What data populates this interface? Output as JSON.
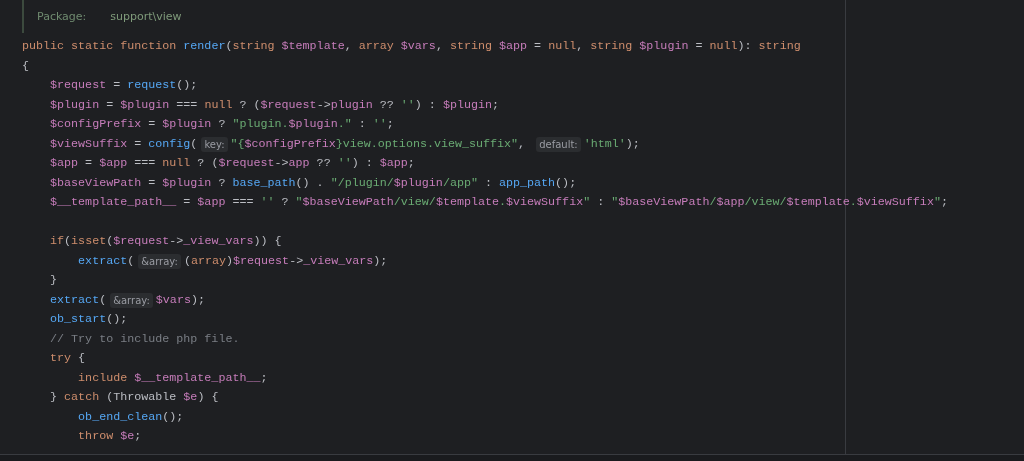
{
  "doc_comment": {
    "label": "Package:",
    "value": "support\\view"
  },
  "lines": [
    {
      "kind": "code",
      "segments": [
        {
          "kind": "code",
          "tokens": [
            {
              "kind": "keyword",
              "text": "public static function "
            },
            {
              "kind": "function",
              "text": "render"
            },
            {
              "kind": "plain",
              "text": "("
            },
            {
              "kind": "keyword",
              "text": "string "
            },
            {
              "kind": "variable",
              "text": "$template"
            },
            {
              "kind": "plain",
              "text": ", "
            },
            {
              "kind": "keyword",
              "text": "array "
            },
            {
              "kind": "variable",
              "text": "$vars"
            },
            {
              "kind": "plain",
              "text": ", "
            },
            {
              "kind": "keyword",
              "text": "string "
            },
            {
              "kind": "variable",
              "text": "$app"
            },
            {
              "kind": "plain",
              "text": " = "
            },
            {
              "kind": "keyword",
              "text": "null"
            },
            {
              "kind": "plain",
              "text": ", "
            },
            {
              "kind": "keyword",
              "text": "string "
            },
            {
              "kind": "variable",
              "text": "$plugin"
            },
            {
              "kind": "plain",
              "text": " = "
            },
            {
              "kind": "keyword",
              "text": "null"
            },
            {
              "kind": "plain",
              "text": "): "
            },
            {
              "kind": "keyword",
              "text": "string"
            }
          ]
        }
      ]
    },
    {
      "kind": "code",
      "segments": [
        {
          "kind": "code",
          "tokens": [
            {
              "kind": "plain",
              "text": "{"
            }
          ]
        }
      ]
    },
    {
      "kind": "code",
      "segments": [
        {
          "kind": "code",
          "tokens": [
            {
              "kind": "variable",
              "text": "    $request"
            },
            {
              "kind": "plain",
              "text": " = "
            },
            {
              "kind": "function",
              "text": "request"
            },
            {
              "kind": "plain",
              "text": "();"
            }
          ]
        }
      ]
    },
    {
      "kind": "code",
      "segments": [
        {
          "kind": "code",
          "tokens": [
            {
              "kind": "variable",
              "text": "    $plugin"
            },
            {
              "kind": "plain",
              "text": " = "
            },
            {
              "kind": "variable",
              "text": "$plugin"
            },
            {
              "kind": "plain",
              "text": " === "
            },
            {
              "kind": "keyword",
              "text": "null"
            },
            {
              "kind": "plain",
              "text": " ? ("
            },
            {
              "kind": "variable",
              "text": "$request"
            },
            {
              "kind": "plain",
              "text": "->"
            },
            {
              "kind": "variable",
              "text": "plugin"
            },
            {
              "kind": "plain",
              "text": " ?? "
            },
            {
              "kind": "string",
              "text": "''"
            },
            {
              "kind": "plain",
              "text": ") : "
            },
            {
              "kind": "variable",
              "text": "$plugin"
            },
            {
              "kind": "plain",
              "text": ";"
            }
          ]
        }
      ]
    },
    {
      "kind": "code",
      "segments": [
        {
          "kind": "code",
          "tokens": [
            {
              "kind": "variable",
              "text": "    $configPrefix"
            },
            {
              "kind": "plain",
              "text": " = "
            },
            {
              "kind": "variable",
              "text": "$plugin"
            },
            {
              "kind": "plain",
              "text": " ? "
            },
            {
              "kind": "string",
              "text": "\"plugin."
            },
            {
              "kind": "variable",
              "text": "$plugin"
            },
            {
              "kind": "string",
              "text": ".\""
            },
            {
              "kind": "plain",
              "text": " : "
            },
            {
              "kind": "string",
              "text": "''"
            },
            {
              "kind": "plain",
              "text": ";"
            }
          ]
        }
      ]
    },
    {
      "kind": "code",
      "segments": [
        {
          "kind": "code",
          "tokens": [
            {
              "kind": "variable",
              "text": "    $viewSuffix"
            },
            {
              "kind": "plain",
              "text": " = "
            },
            {
              "kind": "function",
              "text": "config"
            },
            {
              "kind": "plain",
              "text": "("
            }
          ]
        },
        {
          "kind": "hint",
          "text": "key:"
        },
        {
          "kind": "code",
          "tokens": [
            {
              "kind": "string",
              "text": "\"{"
            },
            {
              "kind": "variable",
              "text": "$configPrefix"
            },
            {
              "kind": "string",
              "text": "}view.options.view_suffix\""
            },
            {
              "kind": "plain",
              "text": ", "
            }
          ]
        },
        {
          "kind": "hint",
          "text": "default:"
        },
        {
          "kind": "code",
          "tokens": [
            {
              "kind": "string",
              "text": "'html'"
            },
            {
              "kind": "plain",
              "text": ");"
            }
          ]
        }
      ]
    },
    {
      "kind": "code",
      "segments": [
        {
          "kind": "code",
          "tokens": [
            {
              "kind": "variable",
              "text": "    $app"
            },
            {
              "kind": "plain",
              "text": " = "
            },
            {
              "kind": "variable",
              "text": "$app"
            },
            {
              "kind": "plain",
              "text": " === "
            },
            {
              "kind": "keyword",
              "text": "null"
            },
            {
              "kind": "plain",
              "text": " ? ("
            },
            {
              "kind": "variable",
              "text": "$request"
            },
            {
              "kind": "plain",
              "text": "->"
            },
            {
              "kind": "variable",
              "text": "app"
            },
            {
              "kind": "plain",
              "text": " ?? "
            },
            {
              "kind": "string",
              "text": "''"
            },
            {
              "kind": "plain",
              "text": ") : "
            },
            {
              "kind": "variable",
              "text": "$app"
            },
            {
              "kind": "plain",
              "text": ";"
            }
          ]
        }
      ]
    },
    {
      "kind": "code",
      "segments": [
        {
          "kind": "code",
          "tokens": [
            {
              "kind": "variable",
              "text": "    $baseViewPath"
            },
            {
              "kind": "plain",
              "text": " = "
            },
            {
              "kind": "variable",
              "text": "$plugin"
            },
            {
              "kind": "plain",
              "text": " ? "
            },
            {
              "kind": "function",
              "text": "base_path"
            },
            {
              "kind": "plain",
              "text": "() . "
            },
            {
              "kind": "string",
              "text": "\"/plugin/"
            },
            {
              "kind": "variable",
              "text": "$plugin"
            },
            {
              "kind": "string",
              "text": "/app\""
            },
            {
              "kind": "plain",
              "text": " : "
            },
            {
              "kind": "function",
              "text": "app_path"
            },
            {
              "kind": "plain",
              "text": "();"
            }
          ]
        }
      ]
    },
    {
      "kind": "code",
      "segments": [
        {
          "kind": "code",
          "tokens": [
            {
              "kind": "variable",
              "text": "    $__template_path__"
            },
            {
              "kind": "plain",
              "text": " = "
            },
            {
              "kind": "variable",
              "text": "$app"
            },
            {
              "kind": "plain",
              "text": " === "
            },
            {
              "kind": "string",
              "text": "''"
            },
            {
              "kind": "plain",
              "text": " ? "
            },
            {
              "kind": "string",
              "text": "\""
            },
            {
              "kind": "variable",
              "text": "$baseViewPath"
            },
            {
              "kind": "string",
              "text": "/view/"
            },
            {
              "kind": "variable",
              "text": "$template"
            },
            {
              "kind": "string",
              "text": "."
            },
            {
              "kind": "variable",
              "text": "$viewSuffix"
            },
            {
              "kind": "string",
              "text": "\""
            },
            {
              "kind": "plain",
              "text": " : "
            },
            {
              "kind": "string",
              "text": "\""
            },
            {
              "kind": "variable",
              "text": "$baseViewPath"
            },
            {
              "kind": "string",
              "text": "/"
            },
            {
              "kind": "variable",
              "text": "$app"
            },
            {
              "kind": "string",
              "text": "/view/"
            },
            {
              "kind": "variable",
              "text": "$template"
            },
            {
              "kind": "string",
              "text": "."
            },
            {
              "kind": "variable",
              "text": "$viewSuffix"
            },
            {
              "kind": "string",
              "text": "\""
            },
            {
              "kind": "plain",
              "text": ";"
            }
          ]
        }
      ]
    },
    {
      "kind": "blank"
    },
    {
      "kind": "code",
      "segments": [
        {
          "kind": "code",
          "tokens": [
            {
              "kind": "keyword",
              "text": "    if"
            },
            {
              "kind": "plain",
              "text": "("
            },
            {
              "kind": "keyword",
              "text": "isset"
            },
            {
              "kind": "plain",
              "text": "("
            },
            {
              "kind": "variable",
              "text": "$request"
            },
            {
              "kind": "plain",
              "text": "->"
            },
            {
              "kind": "variable",
              "text": "_view_vars"
            },
            {
              "kind": "plain",
              "text": ")) {"
            }
          ]
        }
      ]
    },
    {
      "kind": "code",
      "segments": [
        {
          "kind": "code",
          "tokens": [
            {
              "kind": "function",
              "text": "        extract"
            },
            {
              "kind": "plain",
              "text": "("
            }
          ]
        },
        {
          "kind": "hint",
          "text": "&array:"
        },
        {
          "kind": "code",
          "tokens": [
            {
              "kind": "plain",
              "text": "("
            },
            {
              "kind": "keyword",
              "text": "array"
            },
            {
              "kind": "plain",
              "text": ")"
            },
            {
              "kind": "variable",
              "text": "$request"
            },
            {
              "kind": "plain",
              "text": "->"
            },
            {
              "kind": "variable",
              "text": "_view_vars"
            },
            {
              "kind": "plain",
              "text": ");"
            }
          ]
        }
      ]
    },
    {
      "kind": "code",
      "segments": [
        {
          "kind": "code",
          "tokens": [
            {
              "kind": "plain",
              "text": "    }"
            }
          ]
        }
      ]
    },
    {
      "kind": "code",
      "segments": [
        {
          "kind": "code",
          "tokens": [
            {
              "kind": "function",
              "text": "    extract"
            },
            {
              "kind": "plain",
              "text": "("
            }
          ]
        },
        {
          "kind": "hint",
          "text": "&array:"
        },
        {
          "kind": "code",
          "tokens": [
            {
              "kind": "variable",
              "text": "$vars"
            },
            {
              "kind": "plain",
              "text": ");"
            }
          ]
        }
      ]
    },
    {
      "kind": "code",
      "segments": [
        {
          "kind": "code",
          "tokens": [
            {
              "kind": "function",
              "text": "    ob_start"
            },
            {
              "kind": "plain",
              "text": "();"
            }
          ]
        }
      ]
    },
    {
      "kind": "code",
      "segments": [
        {
          "kind": "code",
          "tokens": [
            {
              "kind": "comment",
              "text": "    // Try to include php file."
            }
          ]
        }
      ]
    },
    {
      "kind": "code",
      "segments": [
        {
          "kind": "code",
          "tokens": [
            {
              "kind": "keyword",
              "text": "    try"
            },
            {
              "kind": "plain",
              "text": " {"
            }
          ]
        }
      ]
    },
    {
      "kind": "code",
      "segments": [
        {
          "kind": "code",
          "tokens": [
            {
              "kind": "keyword",
              "text": "        include "
            },
            {
              "kind": "variable",
              "text": "$__template_path__"
            },
            {
              "kind": "plain",
              "text": ";"
            }
          ]
        }
      ]
    },
    {
      "kind": "code",
      "segments": [
        {
          "kind": "code",
          "tokens": [
            {
              "kind": "plain",
              "text": "    } "
            },
            {
              "kind": "keyword",
              "text": "catch"
            },
            {
              "kind": "plain",
              "text": " (Throwable "
            },
            {
              "kind": "variable",
              "text": "$e"
            },
            {
              "kind": "plain",
              "text": ") {"
            }
          ]
        }
      ]
    },
    {
      "kind": "code",
      "segments": [
        {
          "kind": "code",
          "tokens": [
            {
              "kind": "function",
              "text": "        ob_end_clean"
            },
            {
              "kind": "plain",
              "text": "();"
            }
          ]
        }
      ]
    },
    {
      "kind": "code",
      "segments": [
        {
          "kind": "code",
          "tokens": [
            {
              "kind": "keyword",
              "text": "        throw "
            },
            {
              "kind": "variable",
              "text": "$e"
            },
            {
              "kind": "plain",
              "text": ";"
            }
          ]
        }
      ]
    }
  ]
}
